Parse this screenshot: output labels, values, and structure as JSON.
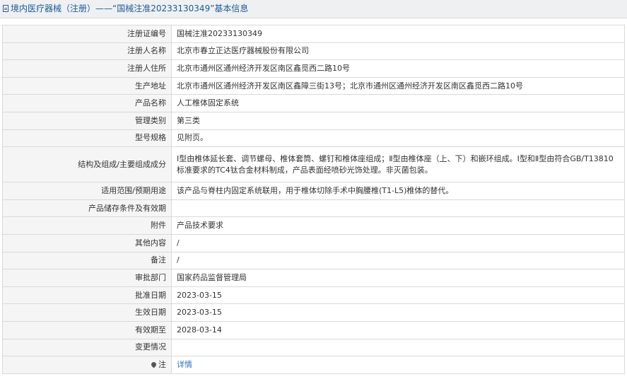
{
  "header": {
    "title": "境内医疗器械（注册）——“国械注准20233130349”基本信息"
  },
  "rows": [
    {
      "label": "注册证编号",
      "value": "国械注准20233130349"
    },
    {
      "label": "注册人名称",
      "value": "北京市春立正达医疗器械股份有限公司"
    },
    {
      "label": "注册人住所",
      "value": "北京市通州区通州经济开发区南区鑫觅西二路10号"
    },
    {
      "label": "生产地址",
      "value": "北京市通州区通州经济开发区南区鑫障三街13号；北京市通州区通州经济开发区南区鑫觅西二路10号"
    },
    {
      "label": "产品名称",
      "value": "人工椎体固定系统"
    },
    {
      "label": "管理类别",
      "value": "第三类"
    },
    {
      "label": "型号规格",
      "value": "见附页。"
    },
    {
      "label": "结构及组成/主要组成成分",
      "value": "Ⅰ型由椎体延长套、调节螺母、椎体套筒、螺钉和椎体座组成；Ⅱ型由椎体座（上、下）和嵌环组成。Ⅰ型和Ⅱ型由符合GB/T13810标准要求的TC4钛合金材料制成，产品表面经喷砂光饰处理。非灭菌包装。"
    },
    {
      "label": "适用范围/预期用途",
      "value": "该产品与脊柱内固定系统联用，用于椎体切除手术中胸腰椎(T1-L5)椎体的替代。"
    },
    {
      "label": "产品储存条件及有效期",
      "value": ""
    },
    {
      "label": "附件",
      "value": "产品技术要求"
    },
    {
      "label": "其他内容",
      "value": "/"
    },
    {
      "label": "备注",
      "value": "/"
    },
    {
      "label": "审批部门",
      "value": "国家药品监督管理局"
    },
    {
      "label": "批准日期",
      "value": "2023-03-15"
    },
    {
      "label": "生效日期",
      "value": "2023-03-15"
    },
    {
      "label": "有效期至",
      "value": "2028-03-14"
    },
    {
      "label": "变更情况",
      "value": ""
    },
    {
      "label": "注",
      "value": "详情"
    }
  ]
}
